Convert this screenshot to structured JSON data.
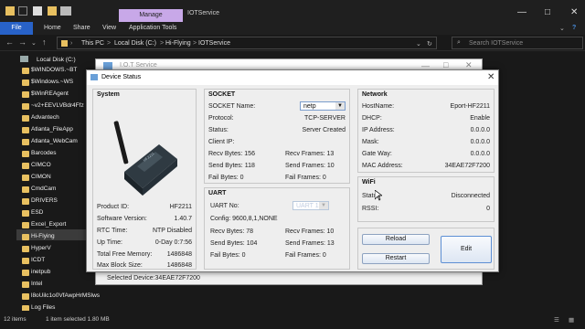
{
  "explorer": {
    "manage_tab": "Manage",
    "title": "IOTService",
    "ribbon": [
      "File",
      "Home",
      "Share",
      "View",
      "Application Tools"
    ],
    "crumbs": [
      "This PC",
      ">",
      "Local Disk (C:)",
      ">",
      "Hi-Flying",
      ">",
      "IOTService"
    ],
    "search_placeholder": "Search IOTService",
    "nav_items": [
      "Local Disk (C:)",
      "$WINDOWS.~BT",
      "$Windows.~WS",
      "$WinREAgent",
      "~v2+EEVLVBdr4Ffz",
      "Advantech",
      "Atlanta_FileApp",
      "Atlanta_WebCam",
      "Barcodes",
      "CIMCO",
      "CIMON",
      "CmdCam",
      "DRIVERS",
      "ESD",
      "Excel_Export",
      "Hi-Flying",
      "HyperV",
      "ICDT",
      "inetpub",
      "Intel",
      "l8oUilc1o0VfAwpHrMSlws",
      "Log Files"
    ],
    "status_items": "12 items",
    "status_selected": "1 item selected  1.80 MB"
  },
  "iot_window": {
    "title": "I.O.T Service",
    "selected_device": "Selected Device:34EAE72F7200"
  },
  "dialog": {
    "title": "Device Status",
    "system": {
      "header": "System",
      "rows": [
        {
          "label": "Product ID:",
          "value": "HF2211"
        },
        {
          "label": "Software Version:",
          "value": "1.40.7"
        },
        {
          "label": "RTC Time:",
          "value": "NTP Disabled"
        },
        {
          "label": "Up Time:",
          "value": "0-Day 0:7:56"
        },
        {
          "label": "Total Free Memory:",
          "value": "1486848"
        },
        {
          "label": "Max Block Size:",
          "value": "1486848"
        }
      ]
    },
    "socket": {
      "header": "SOCKET",
      "name_label": "SOCKET Name:",
      "name_value": "netp",
      "protocol_label": "Protocol:",
      "protocol_value": "TCP-SERVER",
      "status_label": "Status:",
      "status_value": "Server Created",
      "client_ip_label": "Client IP:",
      "recv_bytes": "Recv Bytes: 156",
      "recv_frames": "Recv Frames: 13",
      "send_bytes": "Send Bytes: 118",
      "send_frames": "Send Frames: 10",
      "fail_bytes": "Fail Bytes: 0",
      "fail_frames": "Fail Frames: 0"
    },
    "uart": {
      "header": "UART",
      "no_label": "UART No:",
      "no_value": "UART 1",
      "config": "Config: 9600,8,1,NONE",
      "recv_bytes": "Recv Bytes: 78",
      "recv_frames": "Recv Frames: 10",
      "send_bytes": "Send Bytes: 104",
      "send_frames": "Send Frames: 13",
      "fail_bytes": "Fail Bytes: 0",
      "fail_frames": "Fail Frames: 0"
    },
    "network": {
      "header": "Network",
      "rows": [
        {
          "label": "HostName:",
          "value": "Eport-HF2211"
        },
        {
          "label": "DHCP:",
          "value": "Enable"
        },
        {
          "label": "IP Address:",
          "value": "0.0.0.0"
        },
        {
          "label": "Mask:",
          "value": "0.0.0.0"
        },
        {
          "label": "Gate Way:",
          "value": "0.0.0.0"
        },
        {
          "label": "MAC Address:",
          "value": "34EAE72F7200"
        }
      ]
    },
    "wifi": {
      "header": "WiFi",
      "status_label": "Status",
      "status_value": "Disconnected",
      "rssi_label": "RSSI:",
      "rssi_value": "0"
    },
    "buttons": {
      "reload": "Reload",
      "restart": "Restart",
      "edit": "Edit"
    }
  }
}
